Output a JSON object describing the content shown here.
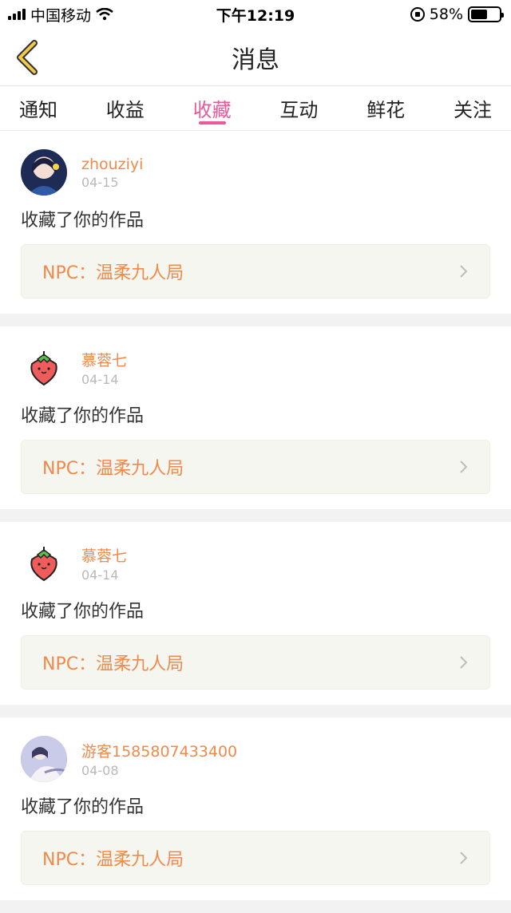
{
  "status_bar": {
    "carrier": "中国移动",
    "time": "下午12:19",
    "battery": "58%",
    "battery_level": 0.58
  },
  "header": {
    "title": "消息"
  },
  "tabs": [
    {
      "label": "通知"
    },
    {
      "label": "收益"
    },
    {
      "label": "收藏"
    },
    {
      "label": "互动"
    },
    {
      "label": "鲜花"
    },
    {
      "label": "关注"
    }
  ],
  "active_tab": "收藏",
  "items": [
    {
      "user": "zhouziyi",
      "date": "04-15",
      "action": "收藏了你的作品",
      "work": "NPC：温柔九人局",
      "avatar": "photo-avatar"
    },
    {
      "user": "慕蓉七",
      "date": "04-14",
      "action": "收藏了你的作品",
      "work": "NPC：温柔九人局",
      "avatar": "strawberry-avatar"
    },
    {
      "user": "慕蓉七",
      "date": "04-14",
      "action": "收藏了你的作品",
      "work": "NPC：温柔九人局",
      "avatar": "strawberry-avatar"
    },
    {
      "user": "游客1585807433400",
      "date": "04-08",
      "action": "收藏了你的作品",
      "work": "NPC：温柔九人局",
      "avatar": "photo-avatar"
    }
  ],
  "colors": {
    "accent_pink": "#e85a9a",
    "accent_orange": "#f08a4b",
    "back_icon_yellow": "#f2c94c"
  }
}
